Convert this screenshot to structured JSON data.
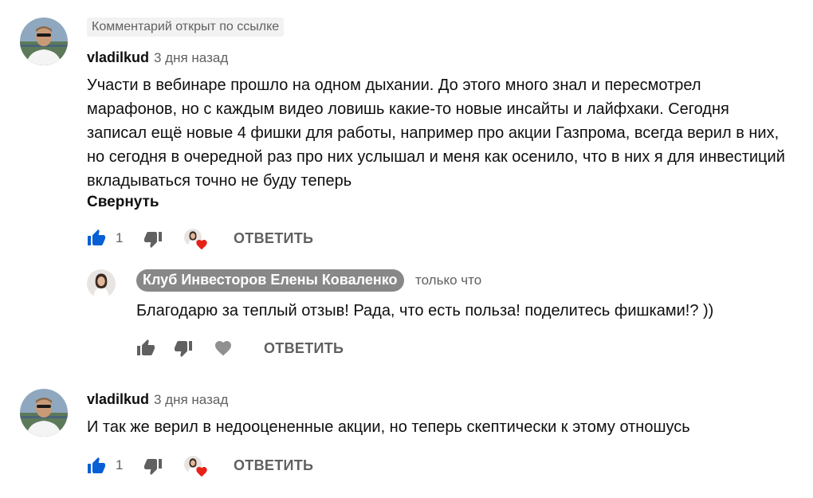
{
  "comments": [
    {
      "pinned_label": "Комментарий открыт по ссылке",
      "author": "vladilkud",
      "time": "3 дня назад",
      "text": "Участи в вебинаре прошло на одном дыхании. До этого много знал и пересмотрел марафонов, но с каждым видео ловишь какие-то новые инсайты и лайфхаки. Сегодня записал ещё новые 4 фишки для работы, например про акции Газпрома, всегда верил в них, но сегодня в очередной раз про них услышал и меня как осенило, что  в них я для инвестиций вкладываться точно не буду теперь",
      "collapse_label": "Свернуть",
      "like_count": "1",
      "reply_label": "ОТВЕТИТЬ",
      "hearted": true
    },
    {
      "author": "vladilkud",
      "time": "3 дня назад",
      "text": "И так же верил в недооцененные акции, но теперь скептически к этому отношусь",
      "like_count": "1",
      "reply_label": "ОТВЕТИТЬ",
      "hearted": true
    }
  ],
  "reply": {
    "author": "Клуб Инвесторов Елены Коваленко",
    "time": "только что",
    "text": "Благодарю за теплый отзыв! Рада, что есть польза! поделитесь фишками!? ))",
    "reply_label": "ОТВЕТИТЬ"
  },
  "colors": {
    "like_active": "#065fd4",
    "icon_gray": "#606060",
    "heart": "#e62117",
    "owner_badge_bg": "#888888"
  },
  "icons": [
    "thumbs-up-icon",
    "thumbs-down-icon",
    "heart-icon",
    "creator-heart-icon"
  ]
}
